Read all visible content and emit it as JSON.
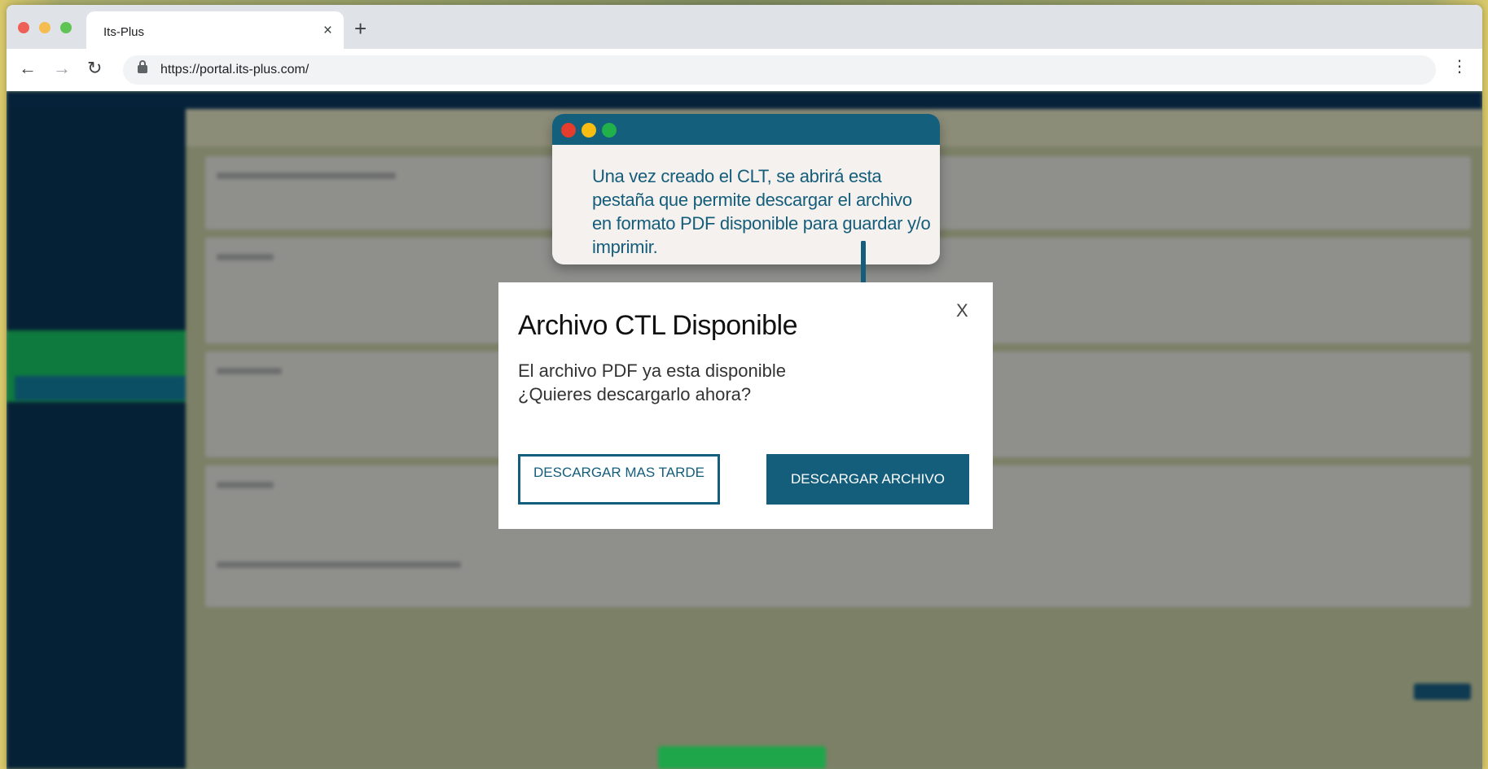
{
  "browser": {
    "tab_title": "Its-Plus",
    "tab_close": "×",
    "new_tab": "+",
    "url": "https://portal.its-plus.com/",
    "back": "←",
    "forward": "→",
    "reload": "↻",
    "menu": "⋮"
  },
  "callout": {
    "text": "Una vez creado el CLT, se abrirá esta pestaña que permite descargar el archivo en formato PDF disponible para guardar y/o imprimir."
  },
  "modal": {
    "close": "X",
    "title": "Archivo CTL Disponible",
    "line1": "El archivo PDF ya esta disponible",
    "line2": "¿Quieres descargarlo ahora?",
    "later_button": "DESCARGAR MAS TARDE",
    "download_button": "DESCARGAR ARCHIVO"
  },
  "colors": {
    "accent": "#145d7b",
    "sidebar": "#052136",
    "active_green": "#0f7a3d"
  }
}
